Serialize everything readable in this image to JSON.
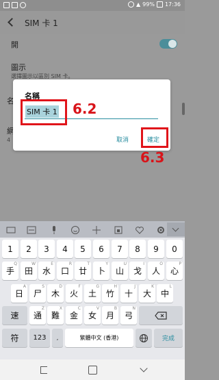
{
  "status_bar": {
    "battery": "99%",
    "time": "17:36"
  },
  "header": {
    "title": "SIM 卡 1"
  },
  "settings": {
    "enable_label": "開",
    "icon_title": "圖示",
    "icon_sub": "選擇圖示以區別 SIM 卡。",
    "name_row_partial": "名",
    "network_row_partial": "網",
    "network_sub_partial": "4"
  },
  "dialog": {
    "title": "名稱",
    "name_value": "SIM 卡 1",
    "cancel_label": "取消",
    "confirm_label": "確定"
  },
  "annotations": {
    "field_step": "6.2",
    "confirm_step": "6.3"
  },
  "keyboard": {
    "toolbar_icons": [
      "keyboard-icon",
      "emoji-grid-icon",
      "microphone-icon",
      "smiley-icon",
      "move-icon",
      "sticker-icon",
      "heart-icon",
      "gear-icon",
      "chevron-down-icon"
    ],
    "numbers": [
      "1",
      "2",
      "3",
      "4",
      "5",
      "6",
      "7",
      "8",
      "9",
      "0"
    ],
    "row1": [
      "手",
      "田",
      "水",
      "口",
      "廿",
      "卜",
      "山",
      "戈",
      "人",
      "心"
    ],
    "row1_sub": [
      "Q",
      "W",
      "E",
      "R",
      "T",
      "Y",
      "U",
      "I",
      "O",
      "P"
    ],
    "row2": [
      "日",
      "尸",
      "木",
      "火",
      "土",
      "竹",
      "十",
      "大",
      "中"
    ],
    "row2_sub": [
      "A",
      "S",
      "D",
      "F",
      "G",
      "H",
      "J",
      "K",
      "L"
    ],
    "shift_label": "速",
    "row3": [
      "通",
      "難",
      "金",
      "女",
      "月",
      "弓"
    ],
    "row3_sub": [
      "Z",
      "X",
      "C",
      "V",
      "B",
      "N"
    ],
    "symbol_label": "符",
    "numeric_label": "123",
    "lang_label": "繁體中文 (香港)",
    "done_label": "完成"
  }
}
